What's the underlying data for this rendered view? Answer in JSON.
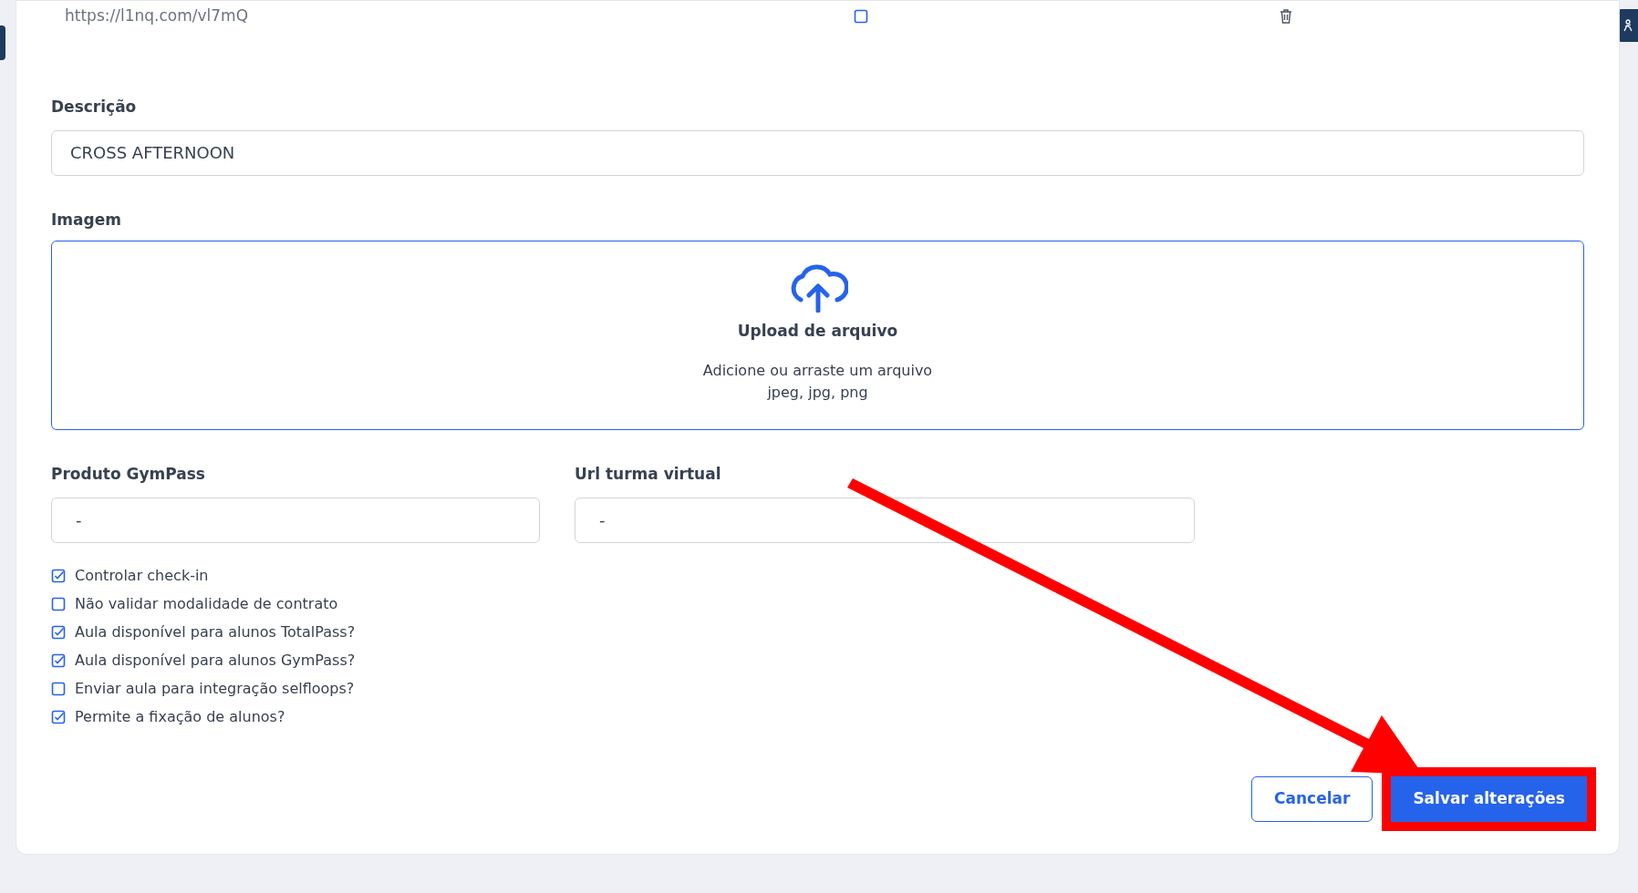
{
  "link_row": {
    "url": "https://l1nq.com/vl7mQ",
    "checked": false
  },
  "description": {
    "label": "Descrição",
    "value": "CROSS AFTERNOON"
  },
  "image": {
    "label": "Imagem",
    "title": "Upload de arquivo",
    "hint": "Adicione ou arraste um arquivo",
    "formats": "jpeg, jpg, png"
  },
  "fields": [
    {
      "label": "Produto GymPass",
      "value": "-"
    },
    {
      "label": "Url turma virtual",
      "value": "-"
    }
  ],
  "options": [
    {
      "label": "Controlar check-in",
      "checked": true
    },
    {
      "label": "Não validar modalidade de contrato",
      "checked": false
    },
    {
      "label": "Aula disponível para alunos TotalPass?",
      "checked": true
    },
    {
      "label": "Aula disponível para alunos GymPass?",
      "checked": true
    },
    {
      "label": "Enviar aula para integração selfloops?",
      "checked": false
    },
    {
      "label": "Permite a fixação de alunos?",
      "checked": true
    }
  ],
  "buttons": {
    "cancel": "Cancelar",
    "save": "Salvar alterações"
  }
}
